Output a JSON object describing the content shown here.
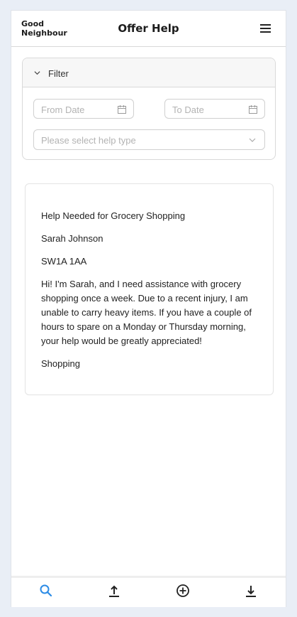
{
  "header": {
    "logo_line1": "Good",
    "logo_line2": "Neighbour",
    "title": "Offer Help",
    "menu_icon": "hamburger-menu-icon"
  },
  "filter": {
    "label": "Filter",
    "expanded": true,
    "from_date_placeholder": "From Date",
    "to_date_placeholder": "To Date",
    "help_type_placeholder": "Please select help type"
  },
  "requests": [
    {
      "title": "Help Needed for Grocery Shopping",
      "name": "Sarah Johnson",
      "postcode": "SW1A 1AA",
      "description": "Hi! I'm Sarah, and I need assistance with grocery shopping once a week. Due to a recent injury, I am unable to carry heavy items. If you have a couple of hours to spare on a Monday or Thursday morning, your help would be greatly appreciated!",
      "category": "Shopping"
    }
  ],
  "bottom_nav": {
    "items": [
      {
        "icon": "search-icon",
        "active": true
      },
      {
        "icon": "upload-icon",
        "active": false
      },
      {
        "icon": "add-circle-icon",
        "active": false
      },
      {
        "icon": "download-icon",
        "active": false
      }
    ]
  },
  "colors": {
    "accent": "#2b8be6",
    "background": "#e9eef6",
    "text": "#222222",
    "placeholder": "#b3b3b3"
  }
}
